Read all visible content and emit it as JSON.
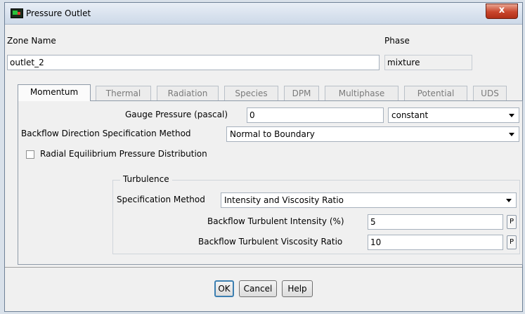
{
  "window": {
    "title": "Pressure Outlet",
    "close_glyph": "x"
  },
  "zone": {
    "name_label": "Zone Name",
    "name_value": "outlet_2"
  },
  "phase": {
    "label": "Phase",
    "value": "mixture"
  },
  "tabs": [
    {
      "label": "Momentum",
      "active": true
    },
    {
      "label": "Thermal",
      "active": false
    },
    {
      "label": "Radiation",
      "active": false
    },
    {
      "label": "Species",
      "active": false
    },
    {
      "label": "DPM",
      "active": false
    },
    {
      "label": "Multiphase",
      "active": false
    },
    {
      "label": "Potential",
      "active": false
    },
    {
      "label": "UDS",
      "active": false
    }
  ],
  "momentum": {
    "gauge_pressure_label": "Gauge Pressure (pascal)",
    "gauge_pressure_value": "0",
    "gauge_pressure_profile": "constant",
    "backflow_direction_label": "Backflow Direction Specification Method",
    "backflow_direction_value": "Normal to Boundary",
    "radial_equilibrium_label": "Radial Equilibrium Pressure Distribution",
    "radial_equilibrium_checked": false
  },
  "turbulence": {
    "group_label": "Turbulence",
    "spec_method_label": "Specification Method",
    "spec_method_value": "Intensity and Viscosity Ratio",
    "intensity_label": "Backflow Turbulent Intensity (%)",
    "intensity_value": "5",
    "viscosity_ratio_label": "Backflow Turbulent Viscosity Ratio",
    "viscosity_ratio_value": "10",
    "parameter_button_label": "P"
  },
  "buttons": {
    "ok": "OK",
    "cancel": "Cancel",
    "help": "Help"
  },
  "colors": {
    "default_button_border": "#3c7fb1",
    "close_button": "#c9452b",
    "inactive_tab_text": "#7a7a7a"
  }
}
